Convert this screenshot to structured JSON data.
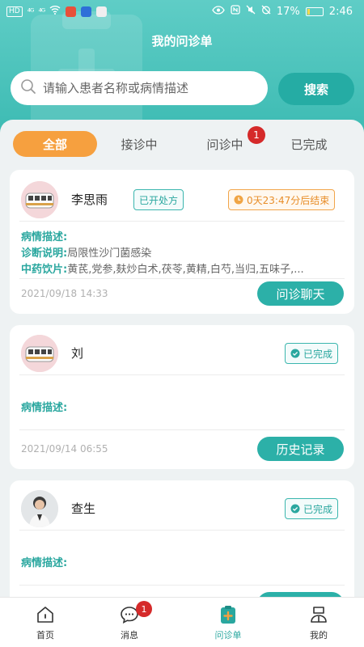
{
  "status_bar": {
    "left_chips": [
      "HD",
      "HD"
    ],
    "signal_text": [
      "⁴ᴳ",
      "⁴ᴳ"
    ],
    "battery_text": "17%",
    "time": "2:46"
  },
  "header": {
    "title": "我的问诊单",
    "search": {
      "placeholder": "请输入患者名称或病情描述",
      "value": ""
    },
    "search_button": "搜索"
  },
  "tabs": [
    {
      "label": "全部",
      "active": true
    },
    {
      "label": "接诊中",
      "active": false
    },
    {
      "label": "问诊中",
      "active": false,
      "badge": "1"
    },
    {
      "label": "已完成",
      "active": false
    }
  ],
  "cards": [
    {
      "name": "李思雨",
      "tag": "已开处方",
      "status": "0天23:47分后结束",
      "fields": [
        {
          "label": "病情描述:",
          "value": ""
        },
        {
          "label": "诊断说明:",
          "value": "局限性沙门菌感染"
        },
        {
          "label": "中药饮片:",
          "value": "黄芪,党参,麸炒白术,茯苓,黄精,白芍,当归,五味子,..."
        }
      ],
      "date": "2021/09/18 14:33",
      "action": "问诊聊天"
    },
    {
      "name": "刘",
      "status": "已完成",
      "fields": [
        {
          "label": "病情描述:",
          "value": ""
        }
      ],
      "date": "2021/09/14 06:55",
      "action": "历史记录"
    },
    {
      "name": "查生",
      "status": "已完成",
      "fields": [
        {
          "label": "病情描述:",
          "value": ""
        }
      ]
    }
  ],
  "bottom_nav": [
    {
      "label": "首页",
      "icon": "home-icon",
      "active": false
    },
    {
      "label": "消息",
      "icon": "message-icon",
      "active": false,
      "badge": "1"
    },
    {
      "label": "问诊单",
      "icon": "clipboard-icon",
      "active": true
    },
    {
      "label": "我的",
      "icon": "profile-icon",
      "active": false
    }
  ],
  "colors": {
    "primary": "#3bbab2",
    "accent": "#f6a03f",
    "badge": "#d52a2a"
  }
}
